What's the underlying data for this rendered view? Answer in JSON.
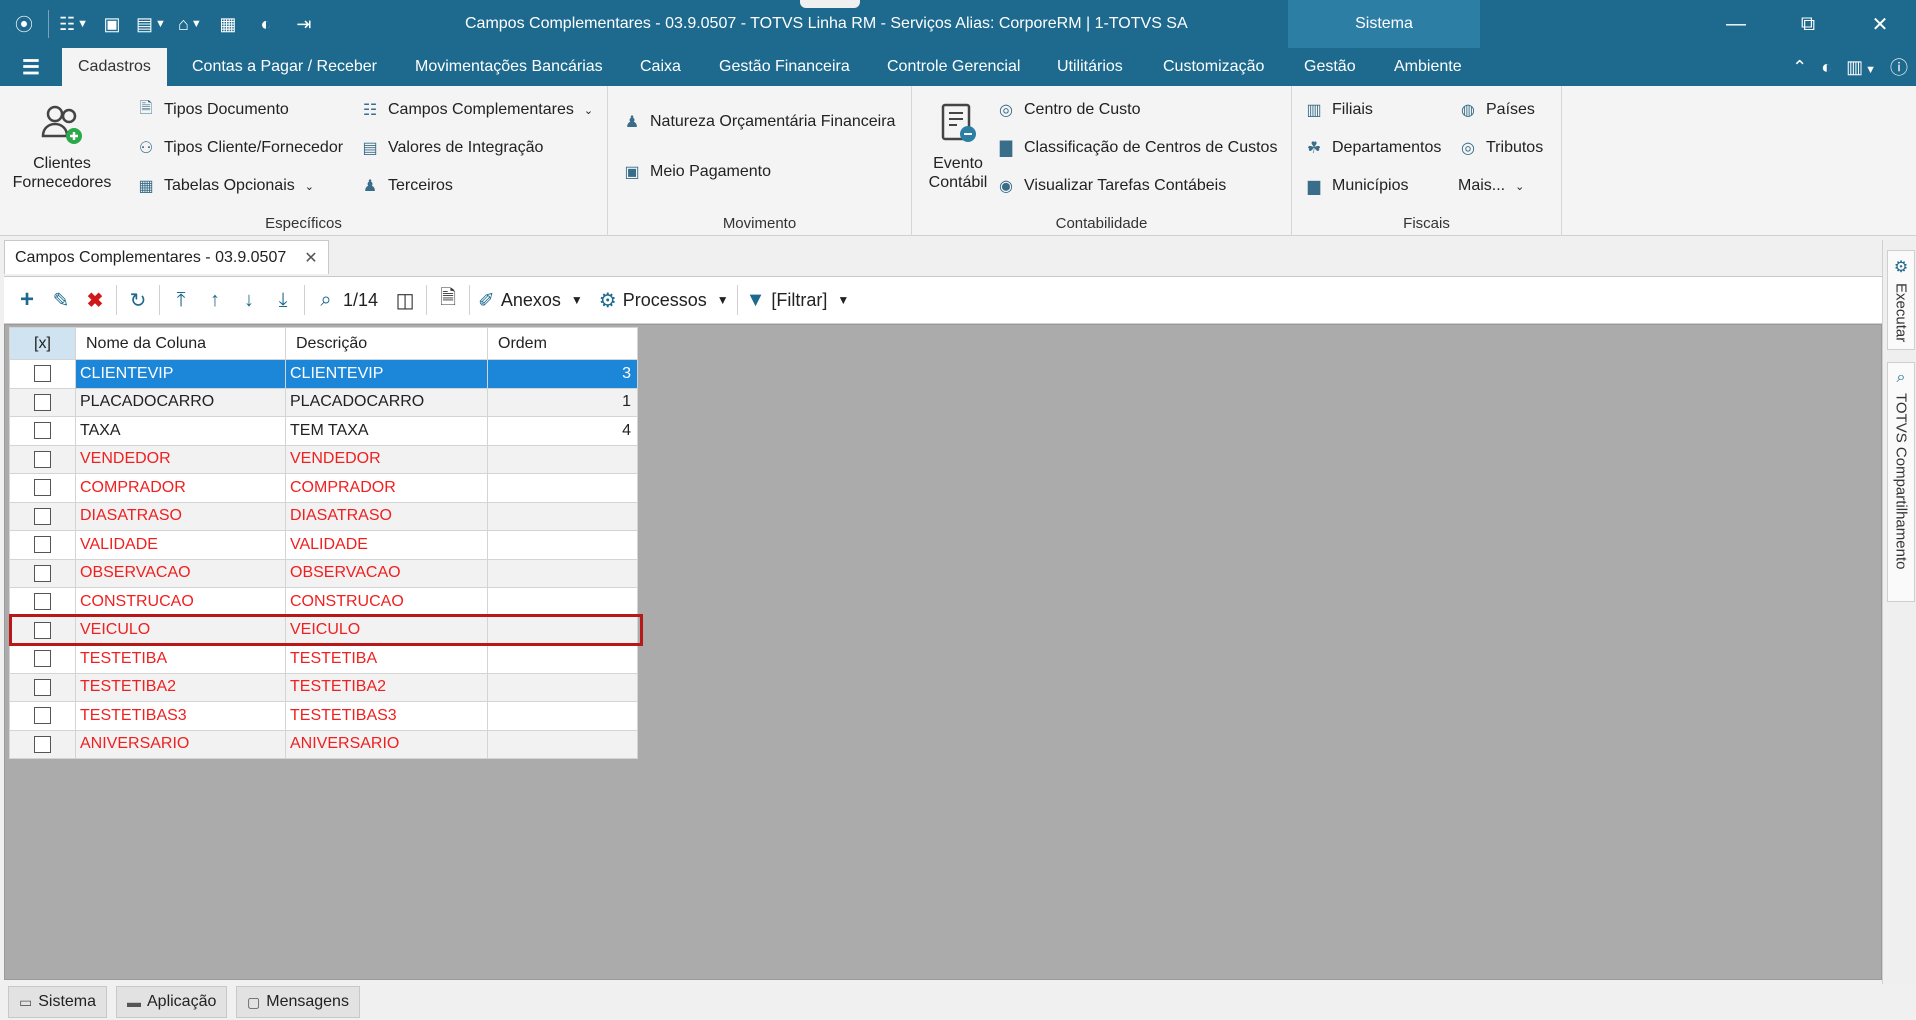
{
  "window": {
    "title": "Campos Complementares - 03.9.0507 - TOTVS Linha RM - Serviços  Alias: CorporeRM | 1-TOTVS SA",
    "sistema_tab": "Sistema"
  },
  "ribbon_tabs": [
    "Cadastros",
    "Contas a Pagar / Receber",
    "Movimentações Bancárias",
    "Caixa",
    "Gestão Financeira",
    "Controle Gerencial",
    "Utilitários",
    "Customização",
    "Gestão",
    "Ambiente"
  ],
  "ribbon": {
    "especificos": {
      "label": "Específicos",
      "big_button": "Clientes Fornecedores",
      "items": [
        "Tipos Documento",
        "Tipos Cliente/Fornecedor",
        "Tabelas Opcionais",
        "Campos Complementares",
        "Valores de Integração",
        "Terceiros"
      ]
    },
    "movimento": {
      "label": "Movimento",
      "items": [
        "Natureza Orçamentária Financeira",
        "Meio Pagamento"
      ]
    },
    "contabilidade": {
      "label": "Contabilidade",
      "big_button": "Evento Contábil",
      "items": [
        "Centro de Custo",
        "Classificação de Centros de Custos",
        "Visualizar Tarefas Contábeis"
      ]
    },
    "fiscais": {
      "label": "Fiscais",
      "items": [
        "Filiais",
        "Departamentos",
        "Municípios",
        "Países",
        "Tributos",
        "Mais..."
      ]
    }
  },
  "document_tab": {
    "label": "Campos Complementares - 03.9.0507"
  },
  "toolbar": {
    "record_counter": "1/14",
    "anexos_label": "Anexos",
    "processos_label": "Processos",
    "filtrar_label": "[Filtrar]"
  },
  "grid": {
    "columns": [
      "[x]",
      "Nome da Coluna",
      "Descrição",
      "Ordem"
    ],
    "rows": [
      {
        "nome": "CLIENTEVIP",
        "descricao": "CLIENTEVIP",
        "ordem": "3"
      },
      {
        "nome": "PLACADOCARRO",
        "descricao": "PLACADOCARRO",
        "ordem": "1"
      },
      {
        "nome": "TAXA",
        "descricao": "TEM TAXA",
        "ordem": "4"
      },
      {
        "nome": "VENDEDOR",
        "descricao": "VENDEDOR",
        "ordem": ""
      },
      {
        "nome": "COMPRADOR",
        "descricao": "COMPRADOR",
        "ordem": ""
      },
      {
        "nome": "DIASATRASO",
        "descricao": "DIASATRASO",
        "ordem": ""
      },
      {
        "nome": "VALIDADE",
        "descricao": "VALIDADE",
        "ordem": ""
      },
      {
        "nome": "OBSERVACAO",
        "descricao": "OBSERVACAO",
        "ordem": ""
      },
      {
        "nome": "CONSTRUCAO",
        "descricao": "CONSTRUCAO",
        "ordem": ""
      },
      {
        "nome": "VEICULO",
        "descricao": "VEICULO",
        "ordem": ""
      },
      {
        "nome": "TESTETIBA",
        "descricao": "TESTETIBA",
        "ordem": ""
      },
      {
        "nome": "TESTETIBA2",
        "descricao": "TESTETIBA2",
        "ordem": ""
      },
      {
        "nome": "TESTETIBAS3",
        "descricao": "TESTETIBAS3",
        "ordem": ""
      },
      {
        "nome": "ANIVERSARIO",
        "descricao": "ANIVERSARIO",
        "ordem": ""
      }
    ]
  },
  "side_panel": {
    "executar": "Executar",
    "compartilhamento": "TOTVS Compartilhamento"
  },
  "status_tabs": [
    "Sistema",
    "Aplicação",
    "Mensagens"
  ],
  "colors": {
    "titlebar": "#1d6a8e",
    "selection": "#1c86d8",
    "error_text": "#f02020",
    "highlight": "#b81818"
  }
}
